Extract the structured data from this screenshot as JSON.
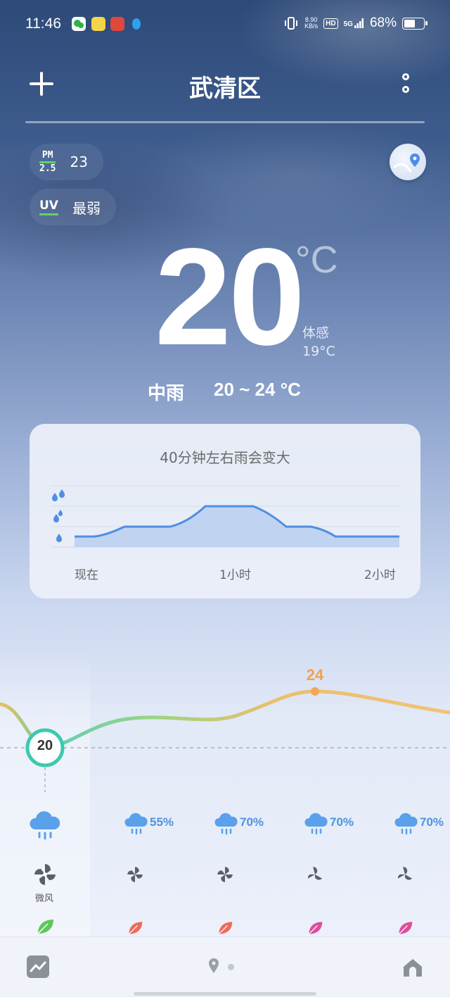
{
  "status_bar": {
    "time": "11:46",
    "net_speed_value": "8.90",
    "net_speed_unit": "KB/s",
    "hd": "HD",
    "signal": "5G",
    "battery_pct": "68%",
    "battery_level": 0.68
  },
  "header": {
    "city": "武清区"
  },
  "air": {
    "pm_top": "PM",
    "pm_bottom": "2.5",
    "pm_value": "23",
    "uv_label": "UV",
    "uv_value": "最弱"
  },
  "current": {
    "temp": "20",
    "unit": "°C",
    "feels_label": "体感",
    "feels_value": "19°C",
    "condition": "中雨",
    "range": "20 ~ 24 °C"
  },
  "precip_card": {
    "title": "40分钟左右雨会变大",
    "labels": [
      "现在",
      "1小时",
      "2小时"
    ]
  },
  "hourly": {
    "current_temp": "20",
    "peak_temp": "24",
    "columns": [
      {
        "pop": "",
        "wind_label": "微风",
        "leaf_color": "#5dc85a"
      },
      {
        "pop": "55%",
        "wind_label": "",
        "leaf_color": "#f06a5a"
      },
      {
        "pop": "70%",
        "wind_label": "",
        "leaf_color": "#f06a5a"
      },
      {
        "pop": "70%",
        "wind_label": "",
        "leaf_color": "#e04d9c"
      },
      {
        "pop": "70%",
        "wind_label": "",
        "leaf_color": "#e04d9c"
      }
    ]
  },
  "icons": {
    "add": "plus-icon",
    "more": "more-icon",
    "location": "map-location-icon",
    "trend": "trend-icon",
    "home": "home-icon"
  }
}
